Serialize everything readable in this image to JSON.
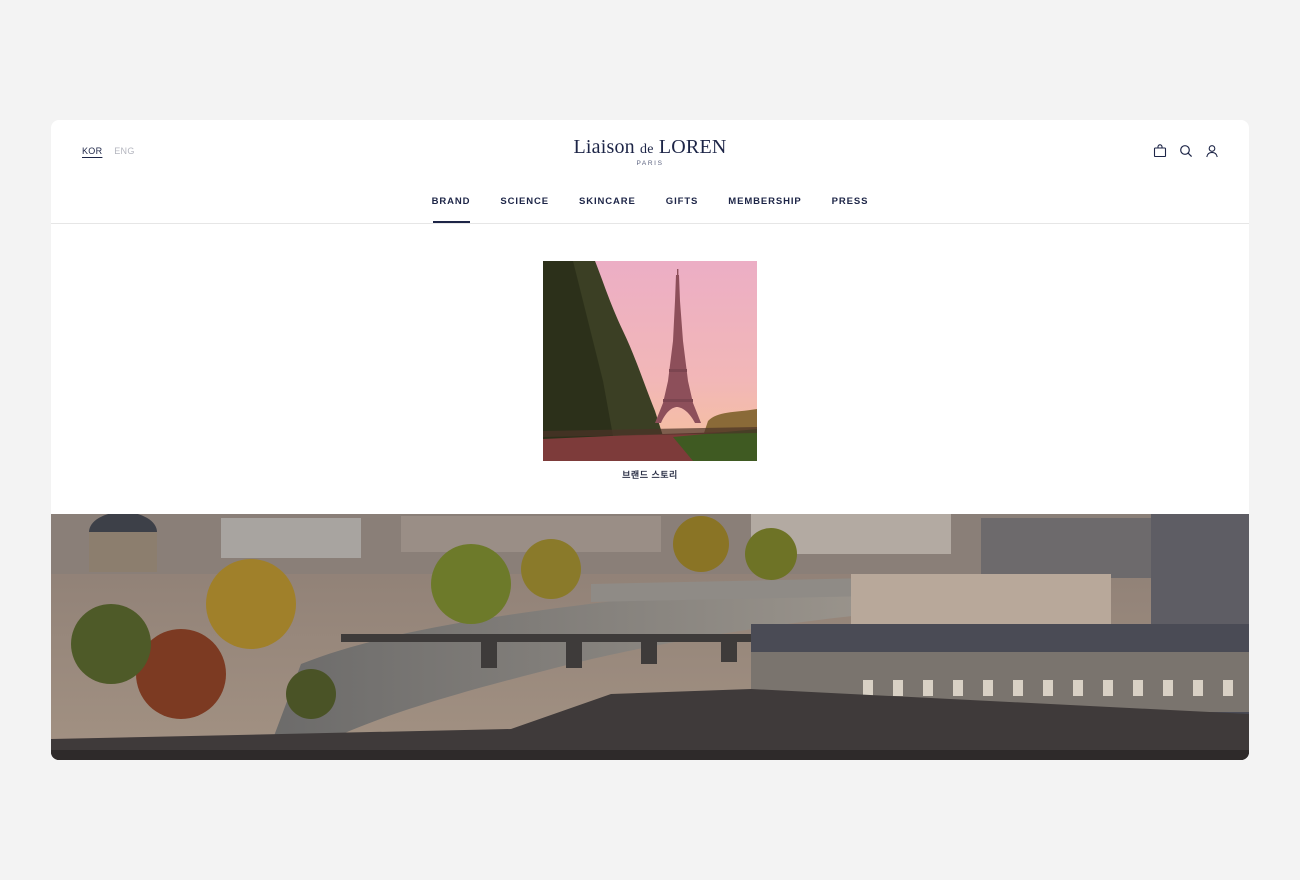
{
  "language": {
    "active": "KOR",
    "inactive": "ENG"
  },
  "logo": {
    "main_prefix": "Liaison",
    "main_de": "de",
    "main_suffix": "LOREN",
    "sub": "PARIS"
  },
  "header_icons": {
    "cart": "shopping-bag-icon",
    "search": "search-icon",
    "account": "user-icon"
  },
  "nav": {
    "items": [
      {
        "label": "BRAND",
        "active": true
      },
      {
        "label": "SCIENCE",
        "active": false
      },
      {
        "label": "SKINCARE",
        "active": false
      },
      {
        "label": "GIFTS",
        "active": false
      },
      {
        "label": "MEMBERSHIP",
        "active": false
      },
      {
        "label": "PRESS",
        "active": false
      }
    ]
  },
  "story": {
    "label": "브랜드 스토리"
  },
  "colors": {
    "brand_navy": "#1d2547",
    "page_bg": "#f3f3f3",
    "inactive_text": "#b4b6bf"
  }
}
